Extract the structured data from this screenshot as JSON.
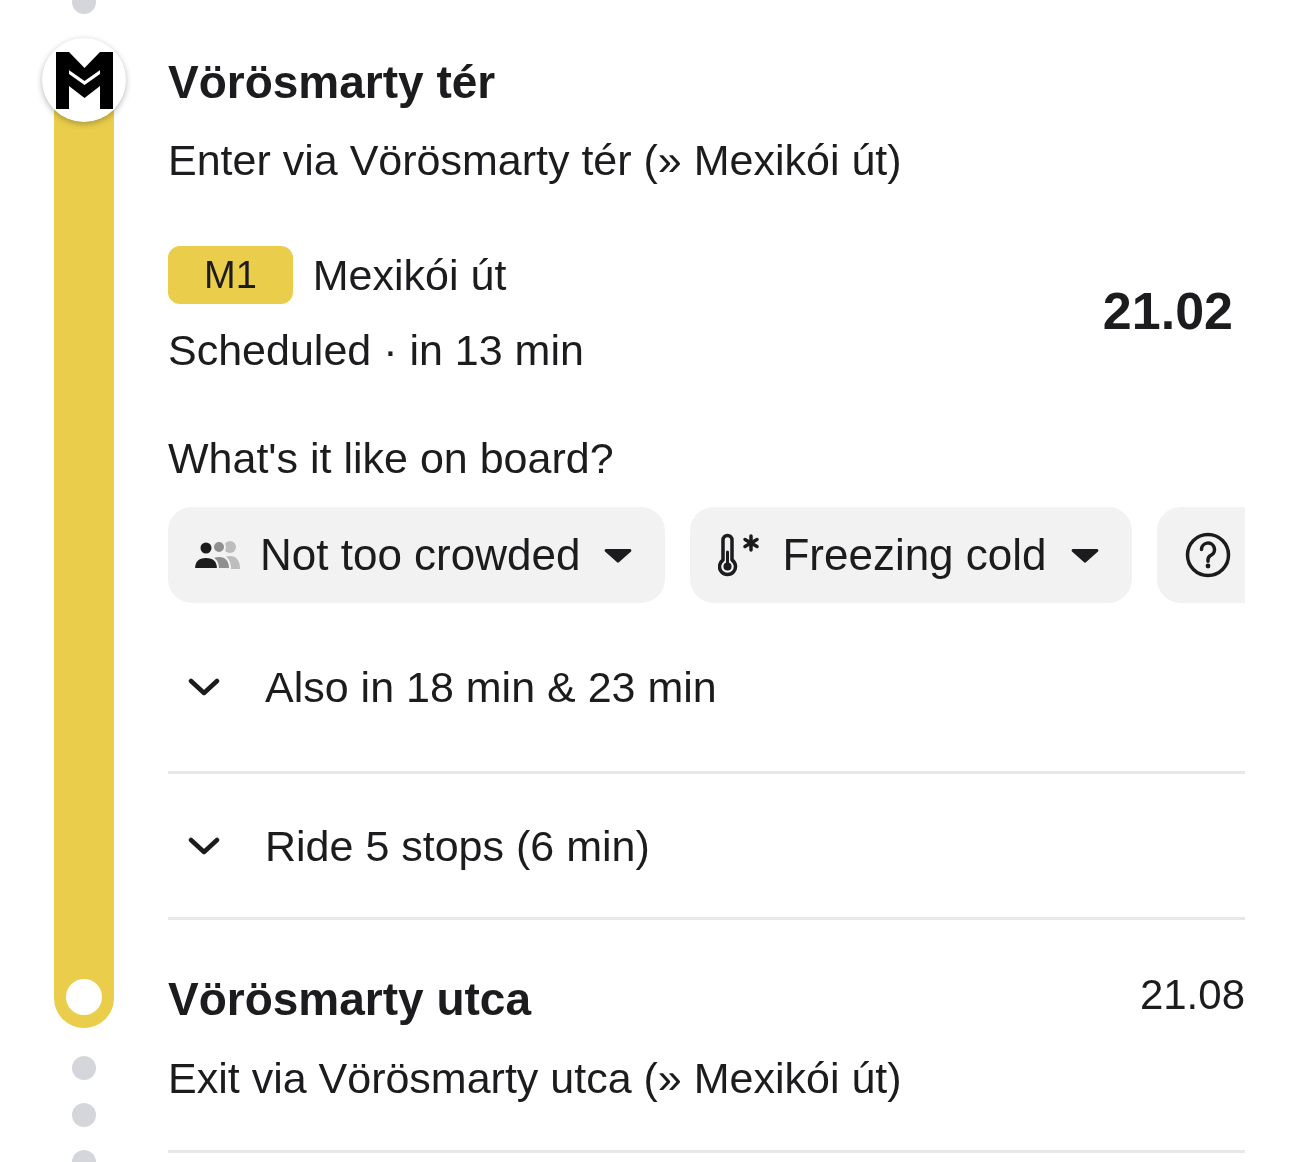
{
  "departure": {
    "stop": "Vörösmarty tér",
    "instruction": "Enter via Vörösmarty tér (» Mexikói út)"
  },
  "transit": {
    "line": "M1",
    "direction": "Mexikói út",
    "status": "Scheduled · in 13 min",
    "departure_time": "21.02"
  },
  "occupancy": {
    "question": "What's it like on board?",
    "chips": [
      {
        "kind": "crowding",
        "label": "Not too crowded"
      },
      {
        "kind": "temperature",
        "label": "Freezing cold"
      },
      {
        "kind": "help"
      }
    ]
  },
  "expanders": [
    {
      "label": "Also in 18 min & 23 min",
      "expanded": false
    },
    {
      "label": "Ride 5 stops (6 min)",
      "expanded": false
    }
  ],
  "arrival": {
    "stop": "Vörösmarty utca",
    "arrival_time": "21.08",
    "instruction": "Exit via Vörösmarty utca (» Mexikói út)"
  }
}
